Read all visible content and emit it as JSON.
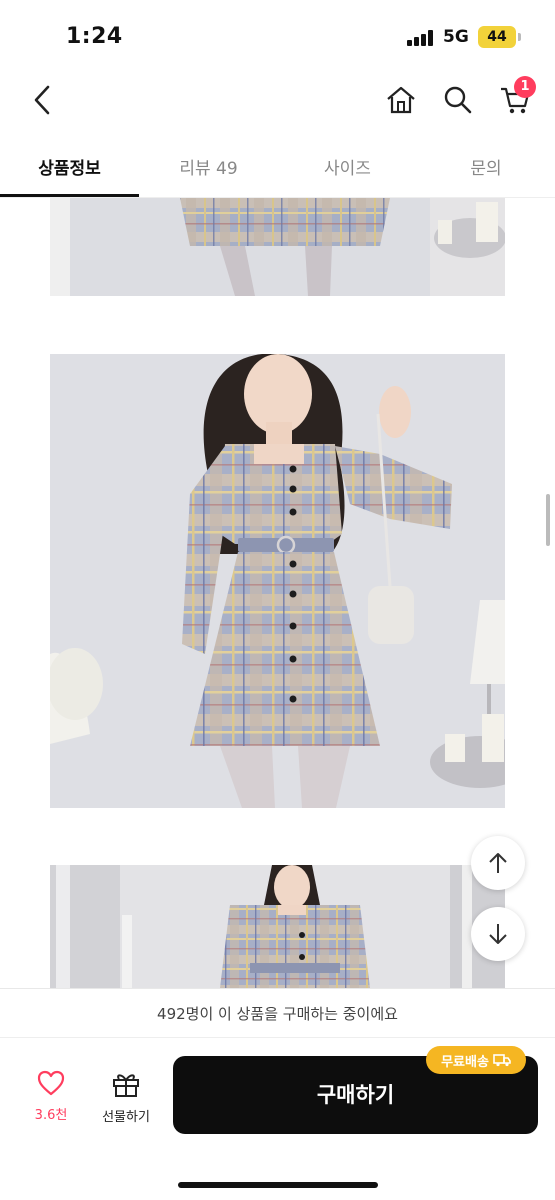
{
  "status": {
    "time": "1:24",
    "network": "5G",
    "battery": "44"
  },
  "header": {
    "cart_badge": "1"
  },
  "tabs": [
    {
      "label": "상품정보"
    },
    {
      "label": "리뷰 49"
    },
    {
      "label": "사이즈"
    },
    {
      "label": "문의"
    }
  ],
  "notice": {
    "text": "492명이 이 상품을 구매하는 중이에요"
  },
  "actions": {
    "like_count": "3.6천",
    "gift_label": "선물하기",
    "buy_label": "구매하기",
    "free_shipping": "무료배송"
  },
  "colors": {
    "accent": "#ff3d5e",
    "buy_button": "#0d0d0d",
    "free_shipping_badge": "#f5b622"
  },
  "icons": [
    "back-icon",
    "home-icon",
    "search-icon",
    "cart-icon",
    "arrow-up-icon",
    "arrow-down-icon",
    "heart-icon",
    "gift-icon",
    "truck-icon"
  ]
}
